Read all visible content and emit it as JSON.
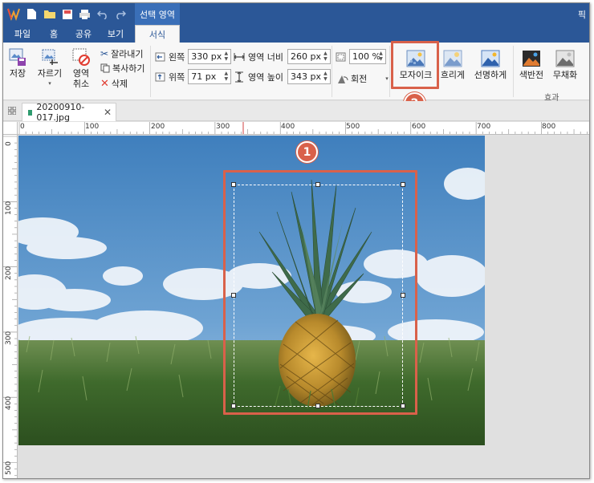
{
  "titlebar": {
    "context_tab": "선택 영역",
    "edge_text": "픽"
  },
  "tabs": [
    {
      "label": "파일"
    },
    {
      "label": "홈"
    },
    {
      "label": "공유"
    },
    {
      "label": "보기"
    },
    {
      "label": "서식"
    }
  ],
  "ribbon": {
    "save_label": "저장",
    "crop_label": "자르기",
    "cancel_area_label_1": "영역",
    "cancel_area_label_2": "취소",
    "cut_label": "잘라내기",
    "copy_label": "복사하기",
    "delete_label": "삭제",
    "left_label": "왼쪽",
    "left_value": "330 px",
    "top_label": "위쪽",
    "top_value": "71 px",
    "width_label": "영역 너비",
    "width_value": "260 px",
    "height_label": "영역 높이",
    "height_value": "343 px",
    "zoom_value": "100 %",
    "rotate_label": "회전",
    "mosaic_label": "모자이크",
    "blur_label": "흐리게",
    "sharpen_label": "선명하게",
    "invert_label": "색반전",
    "grayscale_label": "무채화",
    "effects_group_label": "효과"
  },
  "document": {
    "tab_name": "20200910-017.jpg"
  },
  "ruler": {
    "top_labels": [
      "0",
      "100",
      "200",
      "300",
      "400",
      "500",
      "600",
      "700",
      "800"
    ],
    "left_labels": [
      "0",
      "100",
      "200",
      "300",
      "400",
      "500"
    ]
  },
  "annotations": {
    "badge_1": "1",
    "badge_2": "2",
    "accent_color": "#d9614a"
  }
}
